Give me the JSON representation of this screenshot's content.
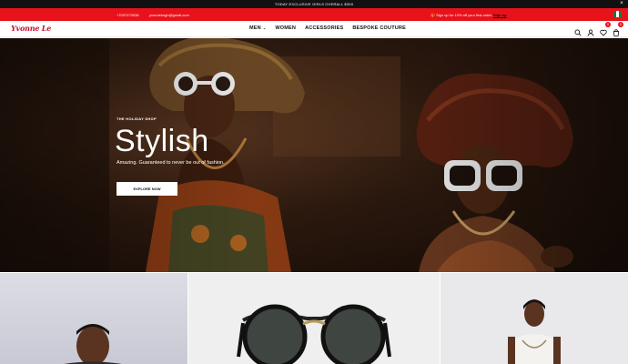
{
  "announcement": {
    "text": "TODAY EXCLUSIVE GIRLS OVERALL $300",
    "close": "×"
  },
  "contact_bar": {
    "phone": "+7037273036",
    "email": "yvonneesgh@gmail.com",
    "promo_prefix": "🎁 Sign up for 10% off your first order.",
    "promo_link": "Sign up"
  },
  "header": {
    "logo": "Yvonne Le",
    "nav": [
      {
        "label": "MEN",
        "has_dropdown": true
      },
      {
        "label": "WOMEN"
      },
      {
        "label": "ACCESSORIES"
      },
      {
        "label": "BESPOKE COUTURE"
      }
    ],
    "icons": [
      "search-icon",
      "user-icon",
      "wishlist-icon",
      "cart-icon"
    ],
    "wishlist_count": "0",
    "cart_count": "0"
  },
  "hero": {
    "eyebrow": "THE HOLIDAY SHOP",
    "title": "Stylish",
    "subtitle": "Amazing. Guaranteed to never be out of fashion.",
    "cta": "EXPLORE NOW"
  },
  "colors": {
    "accent": "#e8121b",
    "dark": "#111111"
  }
}
